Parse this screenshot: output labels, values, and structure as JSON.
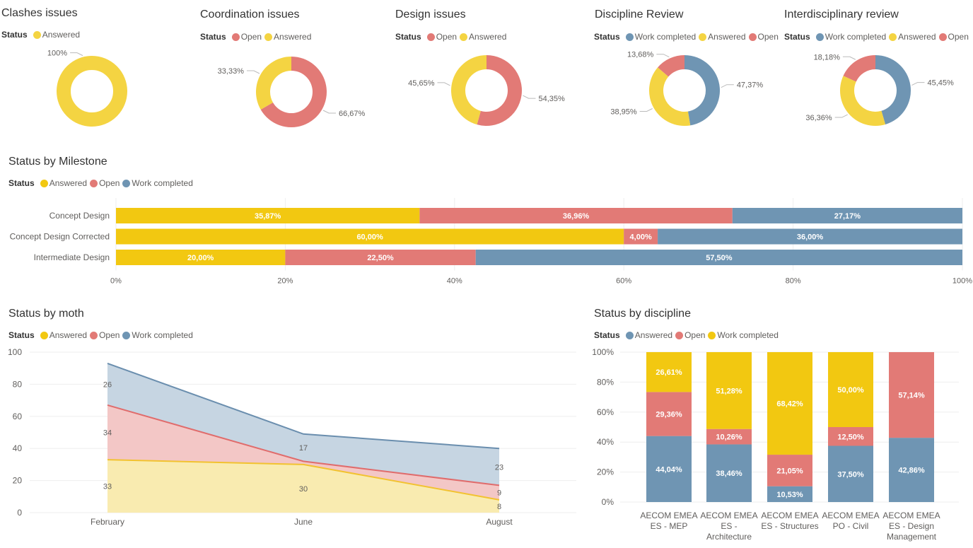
{
  "colors": {
    "answered": "#F2C811",
    "answered_donut": "#F4D442",
    "open": "#E27A76",
    "work_completed": "#6F95B3",
    "answered_area": "#F9EBB0",
    "open_area": "#F3C7C6",
    "work_area": "#C6D5E2",
    "open_line": "#E06C6C",
    "work_line": "#6A8EAE",
    "answered_line": "#F2C230"
  },
  "chart_data": [
    {
      "id": "clashes",
      "type": "pie",
      "title": "Clashes issues",
      "legend_title": "Status",
      "legend": [
        "Answered"
      ],
      "slices": [
        {
          "name": "Answered",
          "value": 100,
          "label": "100%",
          "color_key": "answered_donut"
        }
      ]
    },
    {
      "id": "coordination",
      "type": "pie",
      "title": "Coordination issues",
      "legend_title": "Status",
      "legend": [
        "Open",
        "Answered"
      ],
      "slices": [
        {
          "name": "Open",
          "value": 66.67,
          "label": "66,67%",
          "color_key": "open"
        },
        {
          "name": "Answered",
          "value": 33.33,
          "label": "33,33%",
          "color_key": "answered_donut"
        }
      ]
    },
    {
      "id": "design",
      "type": "pie",
      "title": "Design issues",
      "legend_title": "Status",
      "legend": [
        "Open",
        "Answered"
      ],
      "slices": [
        {
          "name": "Open",
          "value": 54.35,
          "label": "54,35%",
          "color_key": "open"
        },
        {
          "name": "Answered",
          "value": 45.65,
          "label": "45,65%",
          "color_key": "answered_donut"
        }
      ]
    },
    {
      "id": "discipline_review",
      "type": "pie",
      "title": "Discipline Review",
      "legend_title": "Status",
      "legend": [
        "Work completed",
        "Answered",
        "Open"
      ],
      "slices": [
        {
          "name": "Work completed",
          "value": 47.37,
          "label": "47,37%",
          "color_key": "work_completed"
        },
        {
          "name": "Answered",
          "value": 38.95,
          "label": "38,95%",
          "color_key": "answered_donut"
        },
        {
          "name": "Open",
          "value": 13.68,
          "label": "13,68%",
          "color_key": "open"
        }
      ]
    },
    {
      "id": "interdisciplinary",
      "type": "pie",
      "title": "Interdisciplinary review",
      "legend_title": "Status",
      "legend": [
        "Work completed",
        "Answered",
        "Open"
      ],
      "slices": [
        {
          "name": "Work completed",
          "value": 45.45,
          "label": "45,45%",
          "color_key": "work_completed"
        },
        {
          "name": "Answered",
          "value": 36.36,
          "label": "36,36%",
          "color_key": "answered_donut"
        },
        {
          "name": "Open",
          "value": 18.18,
          "label": "18,18%",
          "color_key": "open"
        }
      ]
    },
    {
      "id": "milestone",
      "type": "bar",
      "orientation": "horizontal-100%-stacked",
      "title": "Status by Milestone",
      "legend_title": "Status",
      "categories": [
        "Concept Design",
        "Concept Design Corrected",
        "Intermediate Design"
      ],
      "series": [
        {
          "name": "Answered",
          "color_key": "answered",
          "values": [
            35.87,
            60.0,
            20.0
          ],
          "labels": [
            "35,87%",
            "60,00%",
            "20,00%"
          ]
        },
        {
          "name": "Open",
          "color_key": "open",
          "values": [
            36.96,
            4.0,
            22.5
          ],
          "labels": [
            "36,96%",
            "4,00%",
            "22,50%"
          ]
        },
        {
          "name": "Work completed",
          "color_key": "work_completed",
          "values": [
            27.17,
            36.0,
            57.5
          ],
          "labels": [
            "27,17%",
            "36,00%",
            "57,50%"
          ]
        }
      ],
      "x_ticks": [
        "0%",
        "20%",
        "40%",
        "60%",
        "80%",
        "100%"
      ],
      "xlim": [
        0,
        100
      ],
      "grid": true
    },
    {
      "id": "month",
      "type": "area",
      "stacked": true,
      "title": "Status by moth",
      "legend_title": "Status",
      "x": [
        "February",
        "June",
        "August"
      ],
      "series": [
        {
          "name": "Answered",
          "color_key": "answered",
          "values": [
            33,
            30,
            8
          ]
        },
        {
          "name": "Open",
          "color_key": "open",
          "values": [
            34,
            2,
            9
          ]
        },
        {
          "name": "Work completed",
          "color_key": "work_completed",
          "values": [
            26,
            17,
            23
          ]
        }
      ],
      "data_labels": [
        [
          "33",
          "30",
          "8"
        ],
        [
          "34",
          "",
          "9"
        ],
        [
          "26",
          "17",
          "23"
        ]
      ],
      "y_ticks": [
        "0",
        "20",
        "40",
        "60",
        "80",
        "100"
      ],
      "ylim": [
        0,
        100
      ],
      "grid": true
    },
    {
      "id": "discipline",
      "type": "bar",
      "orientation": "vertical-100%-stacked",
      "title": "Status by discipline",
      "legend_title": "Status",
      "categories": [
        [
          "AECOM EMEA",
          "ES - MEP"
        ],
        [
          "AECOM EMEA",
          "ES -",
          "Architecture"
        ],
        [
          "AECOM EMEA",
          "ES - Structures"
        ],
        [
          "AECOM EMEA",
          "PO - Civil"
        ],
        [
          "AECOM EMEA",
          "ES - Design",
          "Management"
        ]
      ],
      "series": [
        {
          "name": "Answered",
          "color_key": "work_completed",
          "values": [
            44.04,
            38.46,
            10.53,
            37.5,
            42.86
          ],
          "labels": [
            "44,04%",
            "38,46%",
            "10,53%",
            "37,50%",
            "42,86%"
          ]
        },
        {
          "name": "Open",
          "color_key": "open",
          "values": [
            29.36,
            10.26,
            21.05,
            12.5,
            57.14
          ],
          "labels": [
            "29,36%",
            "10,26%",
            "21,05%",
            "12,50%",
            "57,14%"
          ]
        },
        {
          "name": "Work completed",
          "color_key": "answered",
          "values": [
            26.61,
            51.28,
            68.42,
            50.0,
            0
          ],
          "labels": [
            "26,61%",
            "51,28%",
            "68,42%",
            "50,00%",
            ""
          ]
        }
      ],
      "y_ticks": [
        "0%",
        "20%",
        "40%",
        "60%",
        "80%",
        "100%"
      ],
      "ylim": [
        0,
        100
      ],
      "grid": true
    }
  ]
}
